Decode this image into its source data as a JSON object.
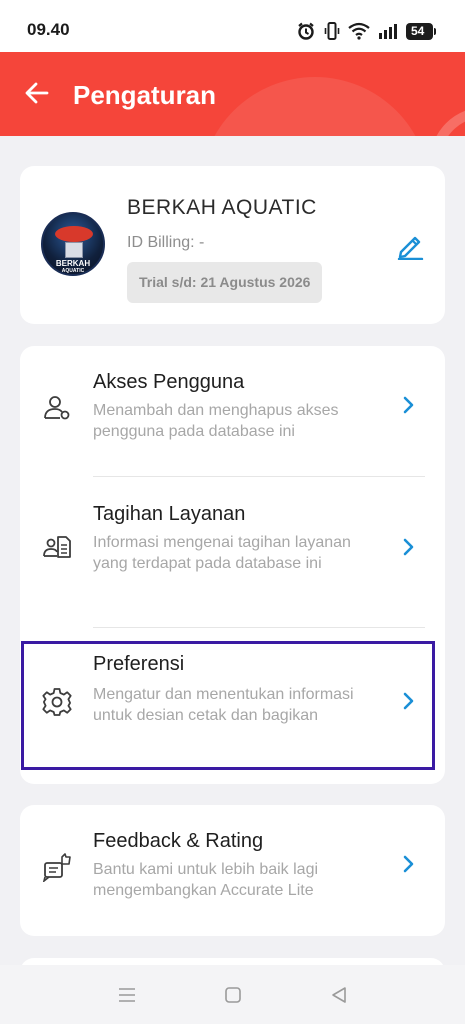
{
  "status_bar": {
    "time": "09.40",
    "battery": "54",
    "icons": [
      "alarm-icon",
      "vibrate-icon",
      "wifi-icon",
      "signal-icon",
      "battery-icon"
    ]
  },
  "app_bar": {
    "title": "Pengaturan",
    "background_color": "#f5453a"
  },
  "profile": {
    "avatar_text": "BERKAH",
    "avatar_subtext": "AQUATIC",
    "company_name": "BERKAH AQUATIC",
    "billing_id": "ID Billing: -",
    "trial": "Trial s/d: 21 Agustus 2026"
  },
  "menu": [
    {
      "title": "Akses Pengguna",
      "description": "Menambah dan menghapus akses pengguna pada database ini",
      "icon": "user-access-icon"
    },
    {
      "title": "Tagihan Layanan",
      "description": "Informasi mengenai tagihan layanan yang terdapat pada database ini",
      "icon": "billing-document-icon"
    },
    {
      "title": "Preferensi",
      "description": "Mengatur dan menentukan informasi untuk desian cetak dan bagikan",
      "icon": "gear-icon",
      "highlighted": true
    }
  ],
  "feedback": {
    "title": "Feedback & Rating",
    "description": "Bantu kami untuk lebih baik lagi mengembangkan Accurate Lite",
    "icon": "feedback-icon"
  },
  "colors": {
    "accent": "#1a8fd6",
    "highlight_border": "#3a1aa3"
  },
  "nav_bar": [
    "menu-icon",
    "home-icon",
    "back-icon"
  ]
}
